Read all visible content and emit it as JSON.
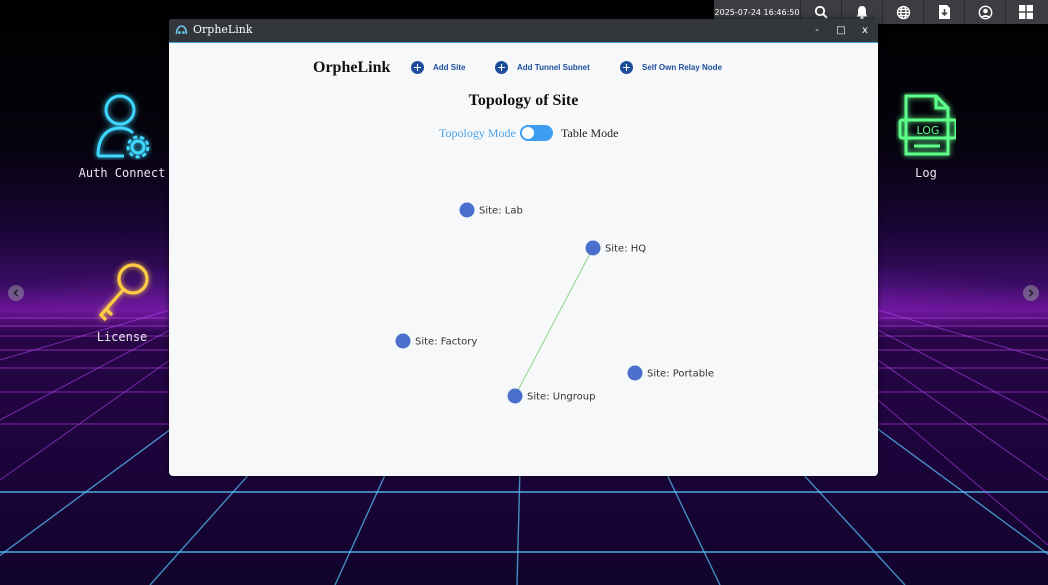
{
  "taskbar": {
    "clock": "2025-07-24 16:46:50",
    "icons": [
      "search-icon",
      "bell-icon",
      "globe-icon",
      "download-icon",
      "user-circle-icon",
      "windows-grid-icon"
    ]
  },
  "desktop": {
    "icons": [
      {
        "label": "Auth Connect",
        "icon": "user-gear-icon",
        "color": "#3fd7ff"
      },
      {
        "label": "License",
        "icon": "key-icon",
        "color": "#ffcc44"
      },
      {
        "label": "Log",
        "icon": "log-file-icon",
        "color": "#5dff8a"
      }
    ]
  },
  "window": {
    "title": "OrpheLink",
    "controls": [
      "-",
      "□",
      "x"
    ]
  },
  "toolbar": {
    "brand": "OrpheLink",
    "add_site": "Add Site",
    "add_tunnel_subnet": "Add Tunnel Subnet",
    "self_own_relay_node": "Self Own Relay Node"
  },
  "page": {
    "title": "Topology of Site",
    "mode_left": "Topology Mode",
    "mode_right": "Table Mode"
  },
  "topology": {
    "node_color": "#4a6fcc",
    "link_color": "#8fd48a",
    "nodes": [
      {
        "id": "lab",
        "label": "Site:  Lab"
      },
      {
        "id": "hq",
        "label": "Site:  HQ"
      },
      {
        "id": "factory",
        "label": "Site:  Factory"
      },
      {
        "id": "portable",
        "label": "Site:  Portable"
      },
      {
        "id": "ungroup",
        "label": "Site:  Ungroup"
      }
    ],
    "links": [
      {
        "source": "hq",
        "target": "ungroup"
      }
    ]
  },
  "colors": {
    "accent": "#1d4e9a",
    "toggle": "#3d9ef0",
    "titlebar": "#33373b"
  }
}
